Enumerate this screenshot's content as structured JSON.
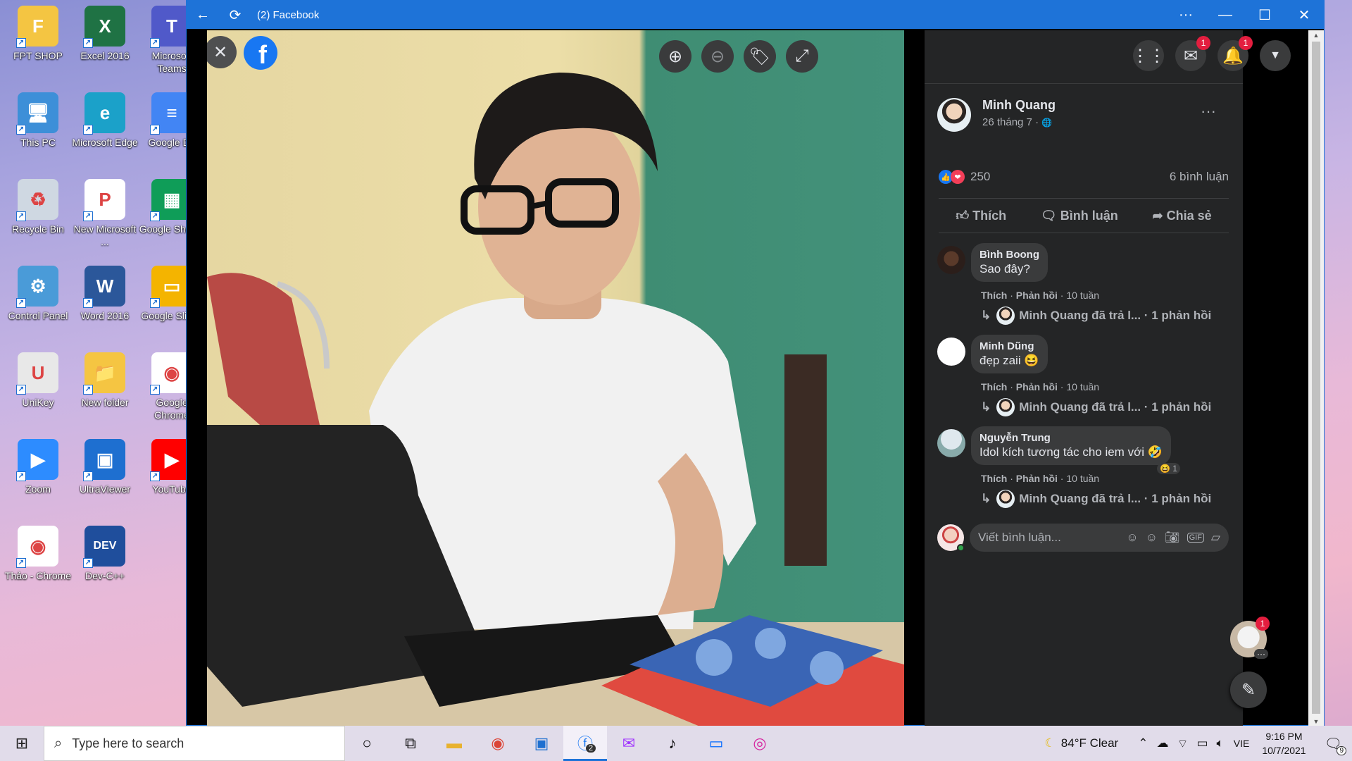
{
  "desktop": {
    "icons": [
      {
        "label": "FPT SHOP",
        "color": "#f4c542",
        "glyph": "F"
      },
      {
        "label": "Excel 2016",
        "color": "#1f7244",
        "glyph": "X"
      },
      {
        "label": "Microsoft Teams",
        "color": "#5059c9",
        "glyph": "T"
      },
      {
        "label": "This PC",
        "color": "#3d8fd8",
        "glyph": "🖥"
      },
      {
        "label": "Microsoft Edge",
        "color": "#1ba1c9",
        "glyph": "e"
      },
      {
        "label": "Google Do",
        "color": "#4285f4",
        "glyph": "≡"
      },
      {
        "label": "Recycle Bin",
        "color": "#cfd8e2",
        "glyph": "♻"
      },
      {
        "label": "New Microsoft ...",
        "color": "#ffffff",
        "glyph": "P"
      },
      {
        "label": "Google Sheets",
        "color": "#0f9d58",
        "glyph": "▦"
      },
      {
        "label": "Control Panel",
        "color": "#4a9bd8",
        "glyph": "⚙"
      },
      {
        "label": "Word 2016",
        "color": "#2b579a",
        "glyph": "W"
      },
      {
        "label": "Google Slides",
        "color": "#f4b400",
        "glyph": "▭"
      },
      {
        "label": "UniKey",
        "color": "#e8e8e8",
        "glyph": "U"
      },
      {
        "label": "New folder",
        "color": "#f5c542",
        "glyph": "📁"
      },
      {
        "label": "Google Chrome",
        "color": "#ffffff",
        "glyph": "◉"
      },
      {
        "label": "Zoom",
        "color": "#2d8cff",
        "glyph": "▶"
      },
      {
        "label": "UltraViewer",
        "color": "#1e6fd0",
        "glyph": "▣"
      },
      {
        "label": "YouTube",
        "color": "#ff0000",
        "glyph": "▶"
      },
      {
        "label": "Thảo - Chrome",
        "color": "#ffffff",
        "glyph": "◉"
      },
      {
        "label": "Dev-C++",
        "color": "#1f4e9c",
        "glyph": "DEV"
      }
    ]
  },
  "window": {
    "title": "(2) Facebook",
    "more": "···"
  },
  "viewer": {
    "close": "✕",
    "logo": "f"
  },
  "header": {
    "messenger_badge": "1",
    "notifications_badge": "1"
  },
  "post": {
    "author": "Minh Quang",
    "date": "26 tháng 7 · ",
    "globe": "🌐",
    "options": "···",
    "reaction_count": "250",
    "comment_count": "6 bình luận",
    "actions": {
      "like": "Thích",
      "comment": "Bình luận",
      "share": "Chia sẻ"
    }
  },
  "comments": [
    {
      "name": "Bình Boong",
      "text": "Sao đây?",
      "like": "Thích",
      "reply": "Phản hồi",
      "age": "10 tuần",
      "reply_summary": "Minh Quang đã trả l... · 1 phản hồi",
      "emoji": "",
      "reaction": ""
    },
    {
      "name": "Minh Dũng",
      "text": "đẹp zaii",
      "like": "Thích",
      "reply": "Phản hồi",
      "age": "10 tuần",
      "reply_summary": "Minh Quang đã trả l... · 1 phản hồi",
      "emoji": "😆",
      "reaction": ""
    },
    {
      "name": "Nguyễn Trung",
      "text": "Idol kích tương tác cho iem với",
      "like": "Thích",
      "reply": "Phản hồi",
      "age": "10 tuần",
      "reply_summary": "Minh Quang đã trả l... · 1 phản hồi",
      "emoji": "🤣",
      "reaction": "😆 1"
    }
  ],
  "composer": {
    "placeholder": "Viết bình luận..."
  },
  "chat_head_badge": "1",
  "taskbar": {
    "search_placeholder": "Type here to search",
    "weather": "84°F  Clear",
    "language": "VIE",
    "time": "9:16 PM",
    "date": "10/7/2021",
    "notif_count": "9",
    "fb_badge": "2"
  }
}
